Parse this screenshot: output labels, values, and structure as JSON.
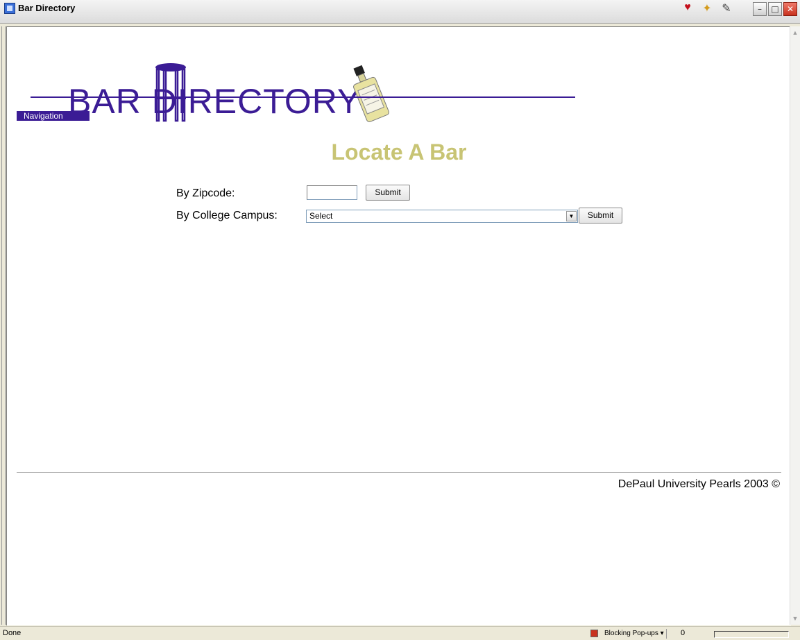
{
  "window": {
    "title": "Bar Directory",
    "minimize_glyph": "–",
    "maximize_glyph": "□",
    "close_glyph": "✕",
    "icons": [
      "heart-icon",
      "star-icon",
      "note-icon"
    ]
  },
  "header": {
    "logo_text": "BAR   DIRECTORY",
    "logo_brand": "#3b1c95",
    "navigation_label": "Navigation"
  },
  "main": {
    "heading": "Locate A Bar",
    "heading_color": "#c8c474",
    "zip_label": "By Zipcode:",
    "zip_value": "",
    "zip_submit": "Submit",
    "campus_label": "By College Campus:",
    "campus_selected": "Select",
    "campus_submit": "Submit"
  },
  "footer": {
    "text": "DePaul University Pearls 2003 ©"
  },
  "statusbar": {
    "status": "Done",
    "popups": "Blocking Pop-ups ▾",
    "count": "0"
  }
}
